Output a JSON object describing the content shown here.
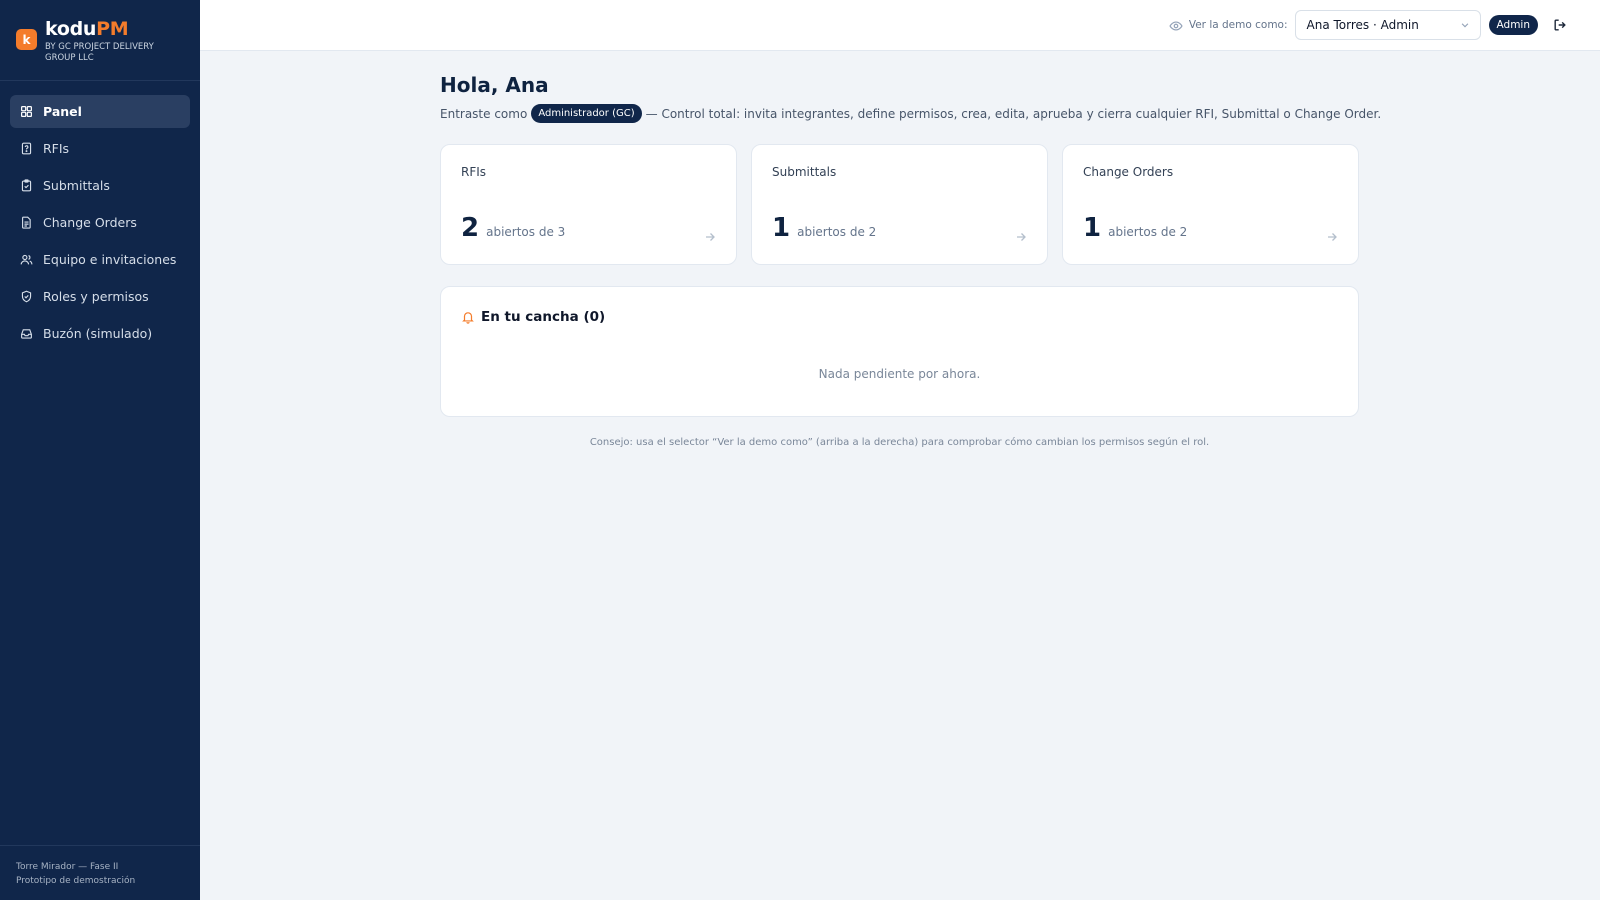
{
  "brand": {
    "logo_letter": "k",
    "name_main": "kodu",
    "name_accent": "PM",
    "subtitle": "BY GC PROJECT DELIVERY GROUP LLC",
    "accent_color": "#f47c2b",
    "sidebar_color": "#10264a"
  },
  "sidebar": {
    "items": [
      {
        "label": "Panel",
        "icon": "grid-icon",
        "active": true
      },
      {
        "label": "RFIs",
        "icon": "question-file-icon",
        "active": false
      },
      {
        "label": "Submittals",
        "icon": "clipboard-check-icon",
        "active": false
      },
      {
        "label": "Change Orders",
        "icon": "document-icon",
        "active": false
      },
      {
        "label": "Equipo e invitaciones",
        "icon": "users-icon",
        "active": false
      },
      {
        "label": "Roles y permisos",
        "icon": "shield-check-icon",
        "active": false
      },
      {
        "label": "Buzón (simulado)",
        "icon": "inbox-icon",
        "active": false
      }
    ],
    "footer": {
      "project": "Torre Mirador — Fase II",
      "note": "Prototipo de demostración"
    }
  },
  "header": {
    "demo_label": "Ver la demo como:",
    "demo_selected": "Ana Torres · Admin",
    "role_badge": "Admin"
  },
  "main": {
    "greeting": "Hola, Ana",
    "intro_prefix": "Entraste como",
    "intro_role": "Administrador (GC)",
    "intro_suffix": "— Control total: invita integrantes, define permisos, crea, edita, aprueba y cierra cualquier RFI, Submittal o Change Order.",
    "cards": [
      {
        "title": "RFIs",
        "count": "2",
        "subtitle": "abiertos de 3"
      },
      {
        "title": "Submittals",
        "count": "1",
        "subtitle": "abiertos de 2"
      },
      {
        "title": "Change Orders",
        "count": "1",
        "subtitle": "abiertos de 2"
      }
    ],
    "pending": {
      "title": "En tu cancha (0)",
      "empty": "Nada pendiente por ahora."
    },
    "tip": "Consejo: usa el selector “Ver la demo como” (arriba a la derecha) para comprobar cómo cambian los permisos según el rol."
  }
}
